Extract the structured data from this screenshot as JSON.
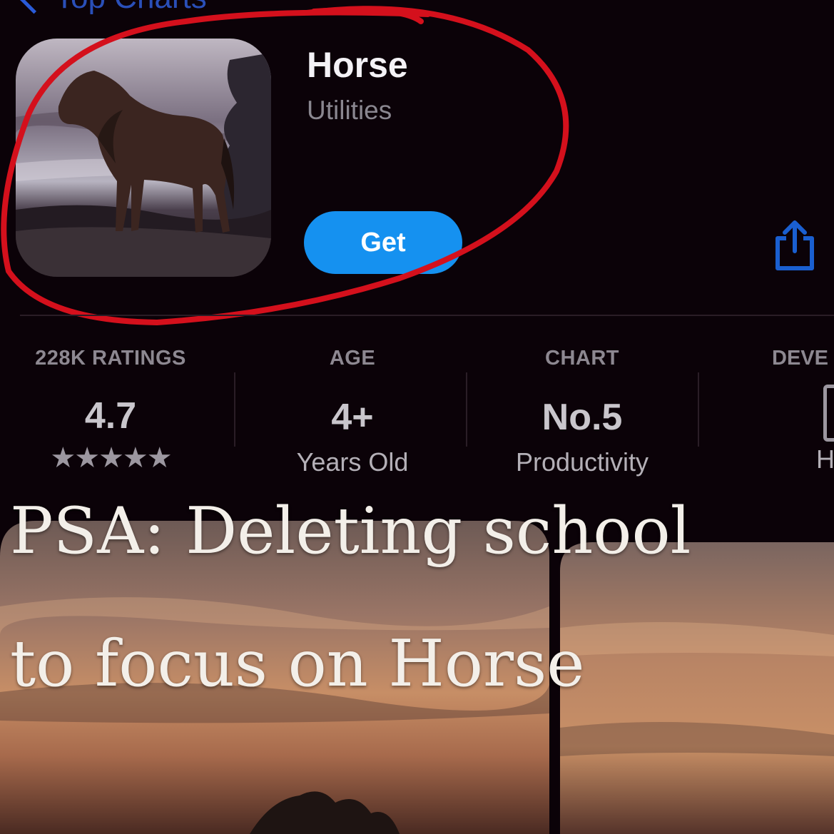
{
  "nav": {
    "back_label": "Top Charts"
  },
  "app": {
    "name": "Horse",
    "category": "Utilities",
    "get_label": "Get"
  },
  "stats": {
    "ratings": {
      "header": "228K RATINGS",
      "value": "4.7",
      "stars": "★★★★★"
    },
    "age": {
      "header": "AGE",
      "value": "4+",
      "sub": "Years Old"
    },
    "chart": {
      "header": "CHART",
      "value": "No.5",
      "sub": "Productivity"
    },
    "developer": {
      "header": "DEVE",
      "sub": "H"
    }
  },
  "caption": {
    "line1": "PSA: Deleting school",
    "line2": "to focus on Horse"
  },
  "icons": [
    "chevron-left-icon",
    "share-icon",
    "star-icon",
    "developer-icon"
  ],
  "colors": {
    "background": "#0b0208",
    "accent_blue": "#1591f0",
    "annotation_red": "#d4101c"
  }
}
